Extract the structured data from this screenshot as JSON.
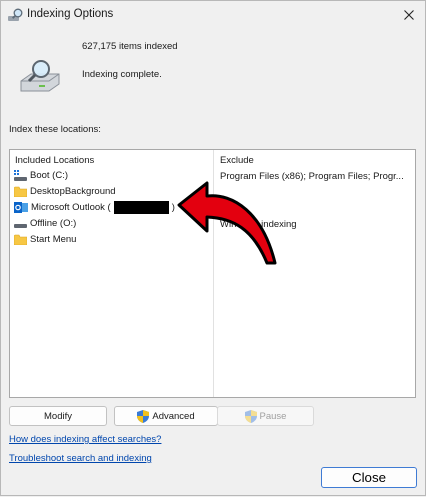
{
  "window": {
    "title": "Indexing Options",
    "icons": {
      "title": "indexing-magnifier-icon",
      "close": "close-icon",
      "status": "drive-magnifier-icon"
    }
  },
  "status": {
    "items_indexed": "627,175 items indexed",
    "message": "Indexing complete."
  },
  "locations_label": "Index these locations:",
  "table": {
    "headers": {
      "included": "Included Locations",
      "exclude": "Exclude"
    },
    "rows": [
      {
        "label": "Boot (C:)",
        "icon": "drive-icon",
        "exclude": "Program Files (x86); Program Files; Progr..."
      },
      {
        "label": "DesktopBackground",
        "icon": "folder-icon",
        "exclude": ""
      },
      {
        "label": "Microsoft Outlook (",
        "label_suffix": ")",
        "icon": "outlook-icon",
        "redacted": true,
        "exclude": ""
      },
      {
        "label": "Offline (O:)",
        "icon": "drive-icon",
        "exclude": "Windows indexing"
      },
      {
        "label": "Start Menu",
        "icon": "folder-icon",
        "exclude": ""
      }
    ]
  },
  "annotation": {
    "type": "red-curved-arrow",
    "color": "#e3000f"
  },
  "buttons": {
    "modify": "Modify",
    "advanced": "Advanced",
    "pause": "Pause",
    "close": "Close"
  },
  "links": {
    "affect": "How does indexing affect searches?",
    "troubleshoot": "Troubleshoot search and indexing"
  },
  "colors": {
    "link": "#0046ad",
    "accent_border": "#3f7bd4",
    "folder": "#f7c744",
    "outlook": "#0a64c9"
  }
}
